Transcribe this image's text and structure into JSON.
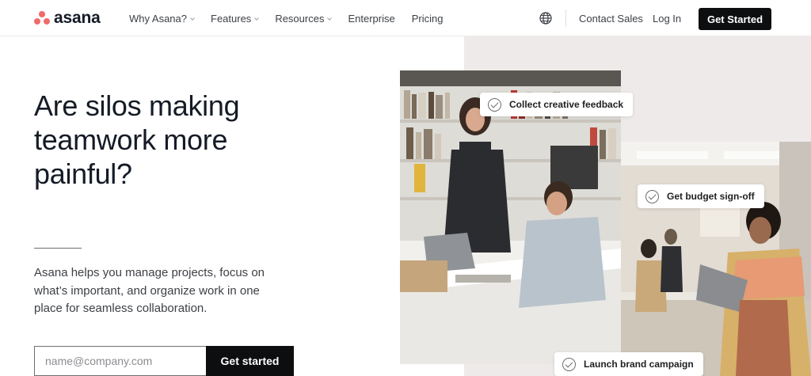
{
  "nav": {
    "logo_text": "asana",
    "links": [
      {
        "label": "Why Asana?",
        "has_dropdown": true
      },
      {
        "label": "Features",
        "has_dropdown": true
      },
      {
        "label": "Resources",
        "has_dropdown": true
      },
      {
        "label": "Enterprise",
        "has_dropdown": false
      },
      {
        "label": "Pricing",
        "has_dropdown": false
      }
    ],
    "globe_icon": "globe-icon",
    "contact_sales": "Contact Sales",
    "login": "Log In",
    "get_started": "Get Started"
  },
  "hero": {
    "headline": "Are silos making teamwork more painful?",
    "description": "Asana helps you manage projects, focus on what’s important, and organize work in one place for seamless collaboration.",
    "email_placeholder": "name@company.com",
    "cta": "Get started"
  },
  "tasks": [
    {
      "label": "Collect creative feedback",
      "icon": "check-circle-icon"
    },
    {
      "label": "Get budget sign-off",
      "icon": "check-circle-icon"
    },
    {
      "label": "Launch brand campaign",
      "icon": "check-circle-icon"
    }
  ],
  "colors": {
    "brand": "#f06a6a",
    "cta_background": "#0d0e10",
    "hero_panel": "#eeeaea"
  }
}
